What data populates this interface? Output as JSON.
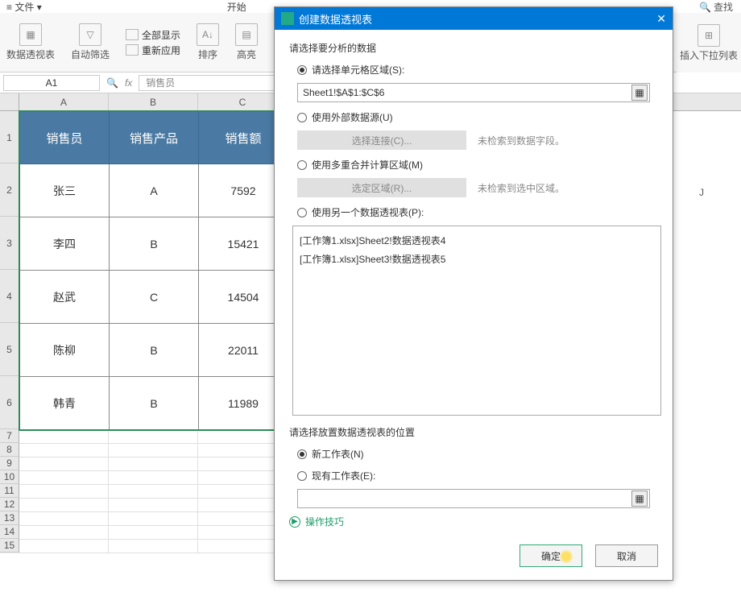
{
  "topbar": {
    "file": "文件",
    "kaishi": "开始"
  },
  "ribbon": {
    "pivot": "数据透视表",
    "autofilter": "自动筛选",
    "showall": "全部显示",
    "reapply": "重新应用",
    "sort": "排序",
    "highlight": "高亮",
    "dropdown": "插入下拉列表",
    "find": "查找"
  },
  "cellref": {
    "name": "A1",
    "fx": "fx",
    "content": "销售员"
  },
  "cols": [
    "A",
    "B",
    "C"
  ],
  "colJ": "J",
  "headers": [
    "销售员",
    "销售产品",
    "销售额"
  ],
  "rows": [
    {
      "r": "2",
      "a": "张三",
      "b": "A",
      "c": "7592"
    },
    {
      "r": "3",
      "a": "李四",
      "b": "B",
      "c": "15421"
    },
    {
      "r": "4",
      "a": "赵武",
      "b": "C",
      "c": "14504"
    },
    {
      "r": "5",
      "a": "陈柳",
      "b": "B",
      "c": "22011"
    },
    {
      "r": "6",
      "a": "韩青",
      "b": "B",
      "c": "11989"
    }
  ],
  "blankrows": [
    "7",
    "8",
    "9",
    "10",
    "11",
    "12",
    "13",
    "14",
    "15"
  ],
  "dialog": {
    "title": "创建数据透视表",
    "sect1": "请选择要分析的数据",
    "opt_range": "请选择单元格区域(S):",
    "range_val": "Sheet1!$A$1:$C$6",
    "opt_ext": "使用外部数据源(U)",
    "ext_btn": "选择连接(C)...",
    "ext_note": "未检索到数据字段。",
    "opt_multi": "使用多重合并计算区域(M)",
    "multi_btn": "选定区域(R)...",
    "multi_note": "未检索到选中区域。",
    "opt_another": "使用另一个数据透视表(P):",
    "list": [
      "[工作簿1.xlsx]Sheet2!数据透视表4",
      "[工作簿1.xlsx]Sheet3!数据透视表5"
    ],
    "sect2": "请选择放置数据透视表的位置",
    "opt_newsheet": "新工作表(N)",
    "opt_existing": "现有工作表(E):",
    "tips": "操作技巧",
    "ok": "确定",
    "cancel": "取消"
  }
}
